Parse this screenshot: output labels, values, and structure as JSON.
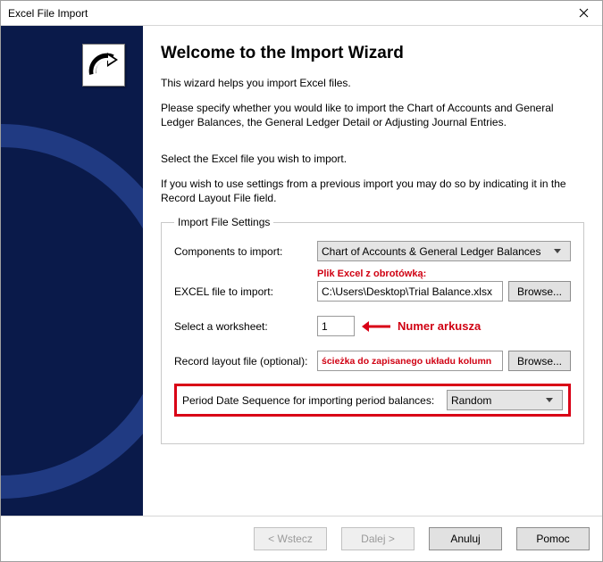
{
  "titlebar": {
    "title": "Excel File Import"
  },
  "main": {
    "heading": "Welcome to the Import Wizard",
    "intro1": "This wizard helps you import Excel files.",
    "intro2": "Please specify whether you would like to import the Chart of Accounts and General Ledger Balances, the General Ledger Detail or Adjusting Journal Entries.",
    "intro3": "Select the Excel file you wish to import.",
    "intro4": "If you wish to use settings from a previous import you may do so by indicating it in the Record Layout File field."
  },
  "settings": {
    "legend": "Import File Settings",
    "components_label": "Components to import:",
    "components_value": "Chart of Accounts & General Ledger Balances",
    "excel_label": "EXCEL file to import:",
    "excel_annot": "Plik Excel z obrotówką:",
    "excel_value": "C:\\Users\\Desktop\\Trial Balance.xlsx",
    "browse": "Browse...",
    "worksheet_label": "Select a worksheet:",
    "worksheet_value": "1",
    "worksheet_annot": "Numer arkusza",
    "layout_label": "Record layout file (optional):",
    "layout_value": "ścieżka do zapisanego układu kolumn",
    "period_label": "Period Date Sequence for importing period balances:",
    "period_value": "Random"
  },
  "footer": {
    "back": "< Wstecz",
    "next": "Dalej >",
    "cancel": "Anuluj",
    "help": "Pomoc"
  }
}
